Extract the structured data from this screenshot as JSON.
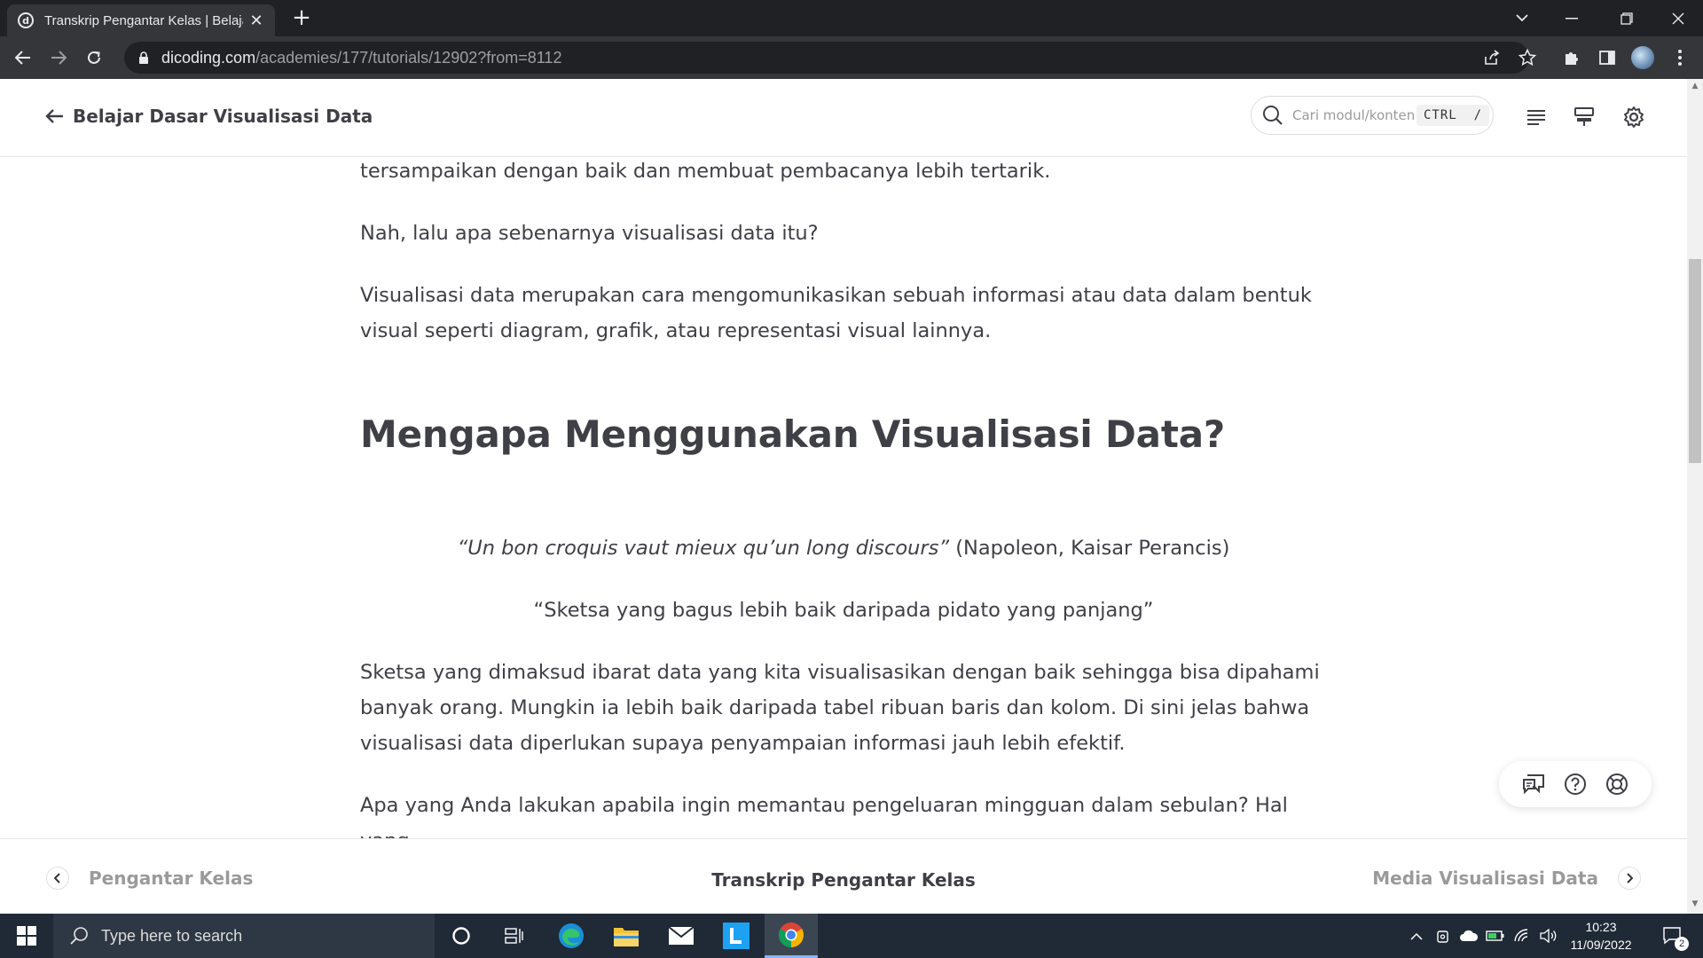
{
  "browser": {
    "tab_title": "Transkrip Pengantar Kelas | Belaja",
    "url_domain": "dicoding.com",
    "url_path": "/academies/177/tutorials/12902?from=8112"
  },
  "header": {
    "back_title": "Belajar Dasar Visualisasi Data",
    "search_placeholder": "Cari modul/konten",
    "shortcut_ctrl": "CTRL",
    "shortcut_key": "/"
  },
  "content": {
    "p1": "tersampaikan dengan baik dan membuat pembacanya lebih tertarik.",
    "p2": "Nah, lalu apa sebenarnya visualisasi data itu?",
    "p3": "Visualisasi data merupakan cara mengomunikasikan sebuah informasi atau data dalam bentuk visual seperti diagram, grafik, atau representasi visual lainnya.",
    "heading": "Mengapa Menggunakan Visualisasi Data?",
    "quote_italic": "“Un bon croquis vaut mieux qu’un long discours”",
    "quote_attrib": " (Napoleon, Kaisar Perancis)",
    "quote_translation": "“Sketsa yang bagus lebih baik daripada pidato yang panjang”",
    "p4": "Sketsa yang dimaksud ibarat data yang kita visualisasikan dengan baik sehingga bisa dipahami banyak orang. Mungkin ia lebih baik daripada tabel ribuan baris dan kolom. Di sini jelas bahwa visualisasi data diperlukan supaya penyampaian informasi jauh lebih efektif.",
    "p5": "Apa yang Anda lakukan apabila ingin memantau pengeluaran mingguan dalam sebulan? Hal yang"
  },
  "bottom_nav": {
    "prev": "Pengantar Kelas",
    "current": "Transkrip Pengantar Kelas",
    "next": "Media Visualisasi Data"
  },
  "taskbar": {
    "search_placeholder": "Type here to search",
    "time": "10:23",
    "date": "11/09/2022",
    "notification_count": "2"
  }
}
